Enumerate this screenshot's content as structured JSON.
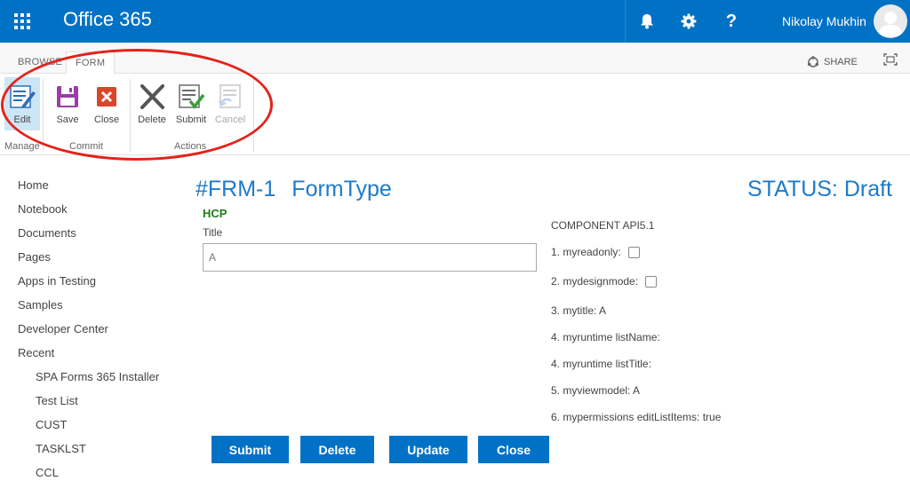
{
  "suite": {
    "brand": "Office 365",
    "user_name": "Nikolay Mukhin",
    "help_label": "?",
    "accent": "#0072c6"
  },
  "ribbon": {
    "tabs": [
      {
        "label": "BROWSE"
      },
      {
        "label": "FORM"
      }
    ],
    "share_label": "SHARE",
    "buttons": {
      "edit": "Edit",
      "save": "Save",
      "close": "Close",
      "delete": "Delete",
      "submit": "Submit",
      "cancel": "Cancel"
    },
    "groups": {
      "manage": "Manage",
      "commit": "Commit",
      "actions": "Actions"
    }
  },
  "nav": {
    "items": [
      {
        "label": "Home"
      },
      {
        "label": "Notebook"
      },
      {
        "label": "Documents"
      },
      {
        "label": "Pages"
      },
      {
        "label": "Apps in Testing"
      },
      {
        "label": "Samples"
      },
      {
        "label": "Developer Center"
      },
      {
        "label": "Recent"
      }
    ],
    "recent": [
      {
        "label": "SPA Forms 365 Installer"
      },
      {
        "label": "Test List"
      },
      {
        "label": "CUST"
      },
      {
        "label": "TASKLST"
      },
      {
        "label": "CCL"
      }
    ]
  },
  "form": {
    "id": "#FRM-1",
    "type": "FormType",
    "status": "STATUS: Draft",
    "section": "HCP",
    "title_label": "Title",
    "title_value": "A",
    "component_title": "COMPONENT API5.1",
    "props": [
      {
        "label": "1. myreadonly:",
        "checkbox": true
      },
      {
        "label": "2. mydesignmode:",
        "checkbox": true
      },
      {
        "label": "3. mytitle: A"
      },
      {
        "label": "4. myruntime listName:"
      },
      {
        "label": "4. myruntime listTitle:"
      },
      {
        "label": "5. myviewmodel: A"
      },
      {
        "label": "6. mypermissions editListItems: true"
      }
    ],
    "actions": {
      "submit": "Submit",
      "delete": "Delete",
      "update": "Update",
      "close": "Close"
    }
  }
}
